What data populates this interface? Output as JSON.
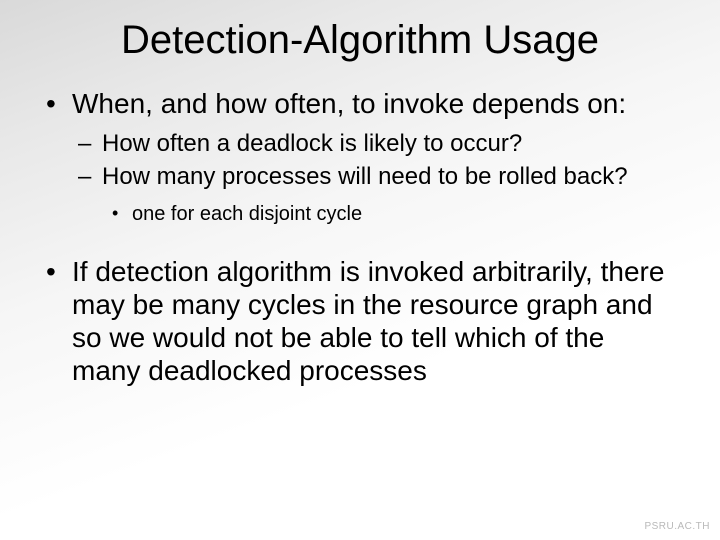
{
  "title": "Detection-Algorithm Usage",
  "bullets": {
    "b1": "When, and how often, to invoke depends on:",
    "b1_1": "How often a deadlock is likely to occur?",
    "b1_2": "How many processes will need to be rolled back?",
    "b1_2_1": "one for each disjoint cycle",
    "b2": "If detection algorithm is invoked arbitrarily, there may be many cycles in the resource graph and so we would not be able to tell which of the many deadlocked processes"
  },
  "watermark": "PSRU.AC.TH"
}
